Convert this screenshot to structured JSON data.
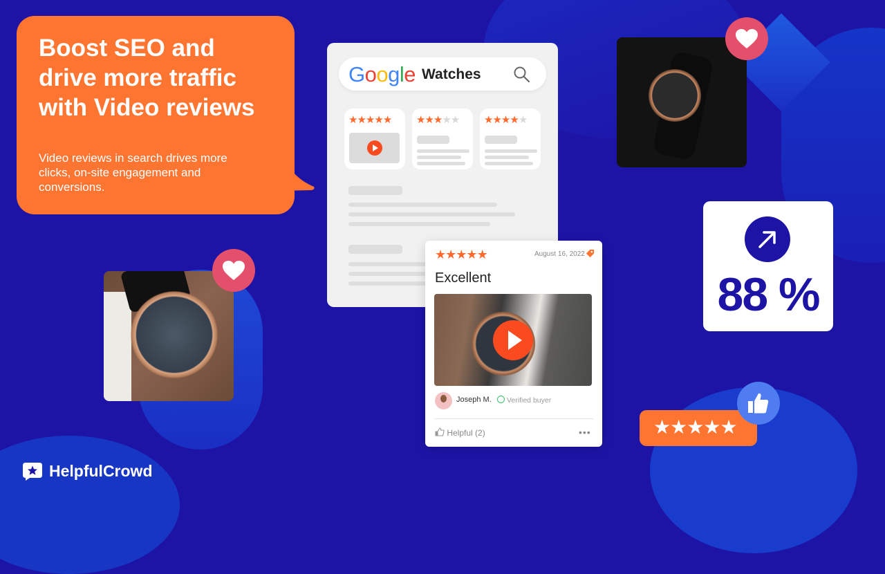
{
  "colors": {
    "background": "#1d14a6",
    "accent_orange": "#fe7431",
    "star_orange": "#fe6a2e",
    "play_red": "#fa4a1f",
    "heart_pink": "#e4506b",
    "thumb_blue": "#4f7cf0"
  },
  "hero": {
    "headline_lines": [
      "Boost SEO and",
      "drive more traffic",
      "with Video reviews"
    ],
    "subtext_lines": [
      "Video reviews in search drives more",
      "clicks, on-site engagement and",
      "conversions."
    ]
  },
  "google_card": {
    "logo_letters": [
      {
        "char": "G",
        "color": "#4285f4"
      },
      {
        "char": "o",
        "color": "#ea4335"
      },
      {
        "char": "o",
        "color": "#fbbc05"
      },
      {
        "char": "g",
        "color": "#4285f4"
      },
      {
        "char": "l",
        "color": "#34a853"
      },
      {
        "char": "e",
        "color": "#ea4335"
      }
    ],
    "query": "Watches",
    "search_icon": "search-icon",
    "results": [
      {
        "rating": 5,
        "max": 5,
        "has_video": true
      },
      {
        "rating": 3,
        "max": 5,
        "has_video": false
      },
      {
        "rating": 4,
        "max": 5,
        "has_video": false
      }
    ]
  },
  "review": {
    "rating": 5,
    "max": 5,
    "date": "August 16, 2022",
    "title": "Excellent",
    "author": "Joseph M.",
    "verified_label": "Verified buyer",
    "helpful_label": "Helpful",
    "helpful_count": "(2)",
    "more_label": "•••"
  },
  "stat": {
    "value": "88 %",
    "icon": "arrow-up-right-icon"
  },
  "rating_pill": {
    "stars": 5
  },
  "brand": {
    "name": "HelpfulCrowd"
  }
}
